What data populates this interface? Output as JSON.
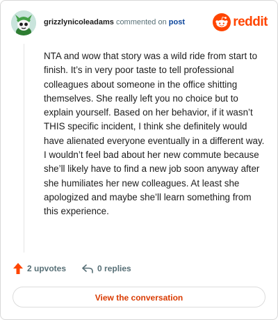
{
  "header": {
    "username": "grizzlynicoleadams",
    "action_text": "commented on",
    "link_text": "post",
    "brand": "reddit"
  },
  "comment": {
    "body": "NTA and wow that story was a wild ride from start to finish. It’s in very poor taste to tell professional colleagues about someone in the office shitting themselves. She really left you no choice but to explain yourself. Based on her behavior, if it wasn’t THIS specific incident, I think she definitely would have alienated everyone eventually in a different way. I wouldn’t feel bad about her new commute because she’ll likely have to find a new job soon anyway after she humiliates her new colleagues. At least she apologized and maybe she’ll learn something from this experience."
  },
  "actions": {
    "upvotes": "2 upvotes",
    "replies": "0 replies"
  },
  "cta": {
    "label": "View the conversation"
  },
  "icons": {
    "avatar": "snoo-avatar-icon",
    "brand": "reddit-logo-icon",
    "upvote": "upvote-arrow-icon",
    "reply": "reply-arrow-icon"
  },
  "colors": {
    "brand": "#ff4500",
    "link": "#0a449b",
    "cta_text": "#d93a00",
    "muted": "#576f76"
  }
}
